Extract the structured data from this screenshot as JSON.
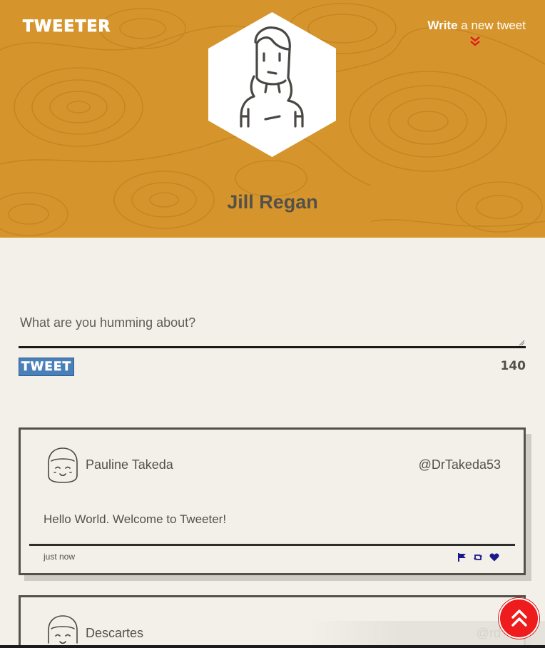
{
  "header": {
    "brand": "TWEETER",
    "write_strong": "Write",
    "write_rest": " a new tweet",
    "user_name": "Jill Regan",
    "bg_color": "#d6952c"
  },
  "compose": {
    "placeholder": "What are you humming about?",
    "button_label": "TWEET",
    "char_count": "140",
    "button_color": "#4a80b9"
  },
  "tweets": [
    {
      "name": "Pauline Takeda",
      "handle": "@DrTakeda53",
      "text": "Hello World. Welcome to Tweeter!",
      "time": "just now",
      "actions": [
        "flag-icon",
        "retweet-icon",
        "heart-icon"
      ]
    },
    {
      "name": "Descartes",
      "handle": "@rd"
    }
  ],
  "colors": {
    "accent": "#ee1c1c",
    "action_icons": "#1a1a8c",
    "text": "#545149"
  },
  "scroll_top": {
    "icon": "double-chevron-up-icon"
  }
}
